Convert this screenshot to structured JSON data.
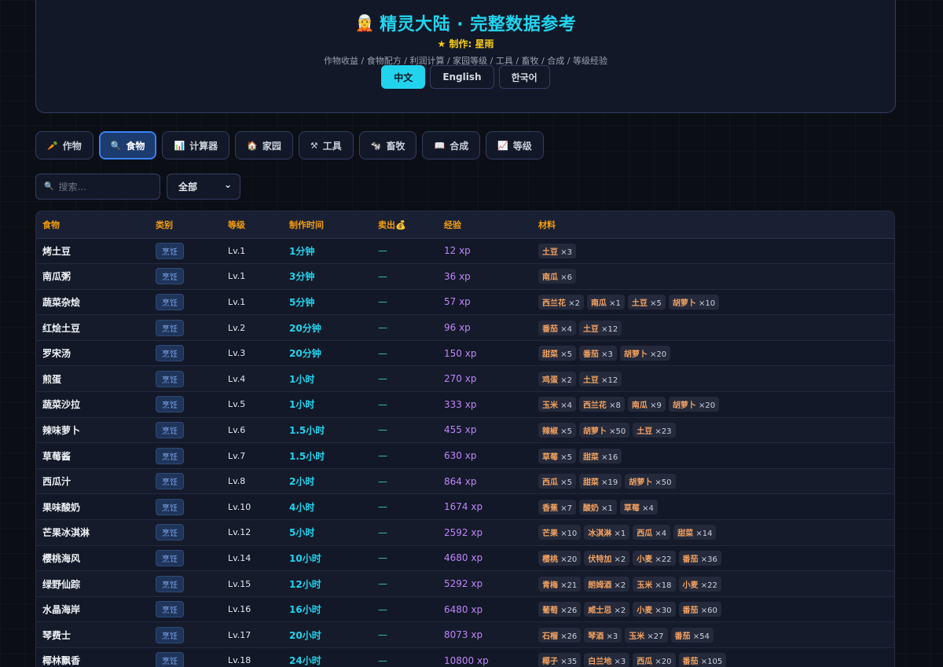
{
  "header": {
    "elf_icon": "🧝",
    "title": "精灵大陆 · 完整数据参考",
    "author": "★ 制作: 星雨",
    "subtitle": "作物收益 / 食物配方 / 利润计算 / 家园等级 / 工具 / 畜牧 / 合成 / 等级经验",
    "langs": [
      "中文",
      "English",
      "한국어"
    ]
  },
  "tabs": [
    {
      "icon": "🥕",
      "label": "作物"
    },
    {
      "icon": "🔍",
      "label": "食物"
    },
    {
      "icon": "📊",
      "label": "计算器"
    },
    {
      "icon": "🏠",
      "label": "家园"
    },
    {
      "icon": "⚒",
      "label": "工具"
    },
    {
      "icon": "🐄",
      "label": "畜牧"
    },
    {
      "icon": "📖",
      "label": "合成"
    },
    {
      "icon": "📈",
      "label": "等级"
    }
  ],
  "filters": {
    "search_icon": "🔍",
    "search_placeholder": "搜索...",
    "select_value": "全部",
    "select_arrow": "⌄"
  },
  "table": {
    "headers": [
      "食物",
      "类别",
      "等级",
      "制作时间",
      "卖出💰",
      "经验",
      "材料"
    ],
    "rows": [
      {
        "name": "烤土豆",
        "cat": "烹饪",
        "lv": "Lv.1",
        "time": "1分钟",
        "sell": "—",
        "xp": "12 xp",
        "mats": [
          [
            "土豆",
            "×3"
          ]
        ]
      },
      {
        "name": "南瓜粥",
        "cat": "烹饪",
        "lv": "Lv.1",
        "time": "3分钟",
        "sell": "—",
        "xp": "36 xp",
        "mats": [
          [
            "南瓜",
            "×6"
          ]
        ]
      },
      {
        "name": "蔬菜杂烩",
        "cat": "烹饪",
        "lv": "Lv.1",
        "time": "5分钟",
        "sell": "—",
        "xp": "57 xp",
        "mats": [
          [
            "西兰花",
            "×2"
          ],
          [
            "南瓜",
            "×1"
          ],
          [
            "土豆",
            "×5"
          ],
          [
            "胡萝卜",
            "×10"
          ]
        ]
      },
      {
        "name": "红烩土豆",
        "cat": "烹饪",
        "lv": "Lv.2",
        "time": "20分钟",
        "sell": "—",
        "xp": "96 xp",
        "mats": [
          [
            "番茄",
            "×4"
          ],
          [
            "土豆",
            "×12"
          ]
        ]
      },
      {
        "name": "罗宋汤",
        "cat": "烹饪",
        "lv": "Lv.3",
        "time": "20分钟",
        "sell": "—",
        "xp": "150 xp",
        "mats": [
          [
            "甜菜",
            "×5"
          ],
          [
            "番茄",
            "×3"
          ],
          [
            "胡萝卜",
            "×20"
          ]
        ]
      },
      {
        "name": "煎蛋",
        "cat": "烹饪",
        "lv": "Lv.4",
        "time": "1小时",
        "sell": "—",
        "xp": "270 xp",
        "mats": [
          [
            "鸡蛋",
            "×2"
          ],
          [
            "土豆",
            "×12"
          ]
        ]
      },
      {
        "name": "蔬菜沙拉",
        "cat": "烹饪",
        "lv": "Lv.5",
        "time": "1小时",
        "sell": "—",
        "xp": "333 xp",
        "mats": [
          [
            "玉米",
            "×4"
          ],
          [
            "西兰花",
            "×8"
          ],
          [
            "南瓜",
            "×9"
          ],
          [
            "胡萝卜",
            "×20"
          ]
        ]
      },
      {
        "name": "辣味萝卜",
        "cat": "烹饪",
        "lv": "Lv.6",
        "time": "1.5小时",
        "sell": "—",
        "xp": "455 xp",
        "mats": [
          [
            "辣椒",
            "×5"
          ],
          [
            "胡萝卜",
            "×50"
          ],
          [
            "土豆",
            "×23"
          ]
        ]
      },
      {
        "name": "草莓酱",
        "cat": "烹饪",
        "lv": "Lv.7",
        "time": "1.5小时",
        "sell": "—",
        "xp": "630 xp",
        "mats": [
          [
            "草莓",
            "×5"
          ],
          [
            "甜菜",
            "×16"
          ]
        ]
      },
      {
        "name": "西瓜汁",
        "cat": "烹饪",
        "lv": "Lv.8",
        "time": "2小时",
        "sell": "—",
        "xp": "864 xp",
        "mats": [
          [
            "西瓜",
            "×5"
          ],
          [
            "甜菜",
            "×19"
          ],
          [
            "胡萝卜",
            "×50"
          ]
        ]
      },
      {
        "name": "果味酸奶",
        "cat": "烹饪",
        "lv": "Lv.10",
        "time": "4小时",
        "sell": "—",
        "xp": "1674 xp",
        "mats": [
          [
            "香蕉",
            "×7"
          ],
          [
            "酸奶",
            "×1"
          ],
          [
            "草莓",
            "×4"
          ]
        ]
      },
      {
        "name": "芒果冰淇淋",
        "cat": "烹饪",
        "lv": "Lv.12",
        "time": "5小时",
        "sell": "—",
        "xp": "2592 xp",
        "mats": [
          [
            "芒果",
            "×10"
          ],
          [
            "冰淇淋",
            "×1"
          ],
          [
            "西瓜",
            "×4"
          ],
          [
            "甜菜",
            "×14"
          ]
        ]
      },
      {
        "name": "樱桃海风",
        "cat": "烹饪",
        "lv": "Lv.14",
        "time": "10小时",
        "sell": "—",
        "xp": "4680 xp",
        "mats": [
          [
            "樱桃",
            "×20"
          ],
          [
            "伏特加",
            "×2"
          ],
          [
            "小麦",
            "×22"
          ],
          [
            "番茄",
            "×36"
          ]
        ]
      },
      {
        "name": "绿野仙踪",
        "cat": "烹饪",
        "lv": "Lv.15",
        "time": "12小时",
        "sell": "—",
        "xp": "5292 xp",
        "mats": [
          [
            "青梅",
            "×21"
          ],
          [
            "朗姆酒",
            "×2"
          ],
          [
            "玉米",
            "×18"
          ],
          [
            "小麦",
            "×22"
          ]
        ]
      },
      {
        "name": "水晶海岸",
        "cat": "烹饪",
        "lv": "Lv.16",
        "time": "16小时",
        "sell": "—",
        "xp": "6480 xp",
        "mats": [
          [
            "葡萄",
            "×26"
          ],
          [
            "威士忌",
            "×2"
          ],
          [
            "小麦",
            "×30"
          ],
          [
            "番茄",
            "×60"
          ]
        ]
      },
      {
        "name": "琴费士",
        "cat": "烹饪",
        "lv": "Lv.17",
        "time": "20小时",
        "sell": "—",
        "xp": "8073 xp",
        "mats": [
          [
            "石榴",
            "×26"
          ],
          [
            "琴酒",
            "×3"
          ],
          [
            "玉米",
            "×27"
          ],
          [
            "番茄",
            "×54"
          ]
        ]
      },
      {
        "name": "椰林飘香",
        "cat": "烹饪",
        "lv": "Lv.18",
        "time": "24小时",
        "sell": "—",
        "xp": "10800 xp",
        "mats": [
          [
            "椰子",
            "×35"
          ],
          [
            "白兰地",
            "×3"
          ],
          [
            "西瓜",
            "×20"
          ],
          [
            "番茄",
            "×105"
          ]
        ]
      }
    ]
  },
  "colors": {
    "accent": "#22d3ee",
    "author": "#facc15",
    "header_text": "#f59e0b",
    "xp": "#c084fc",
    "sell": "#34d399",
    "material": "#f4a261"
  }
}
